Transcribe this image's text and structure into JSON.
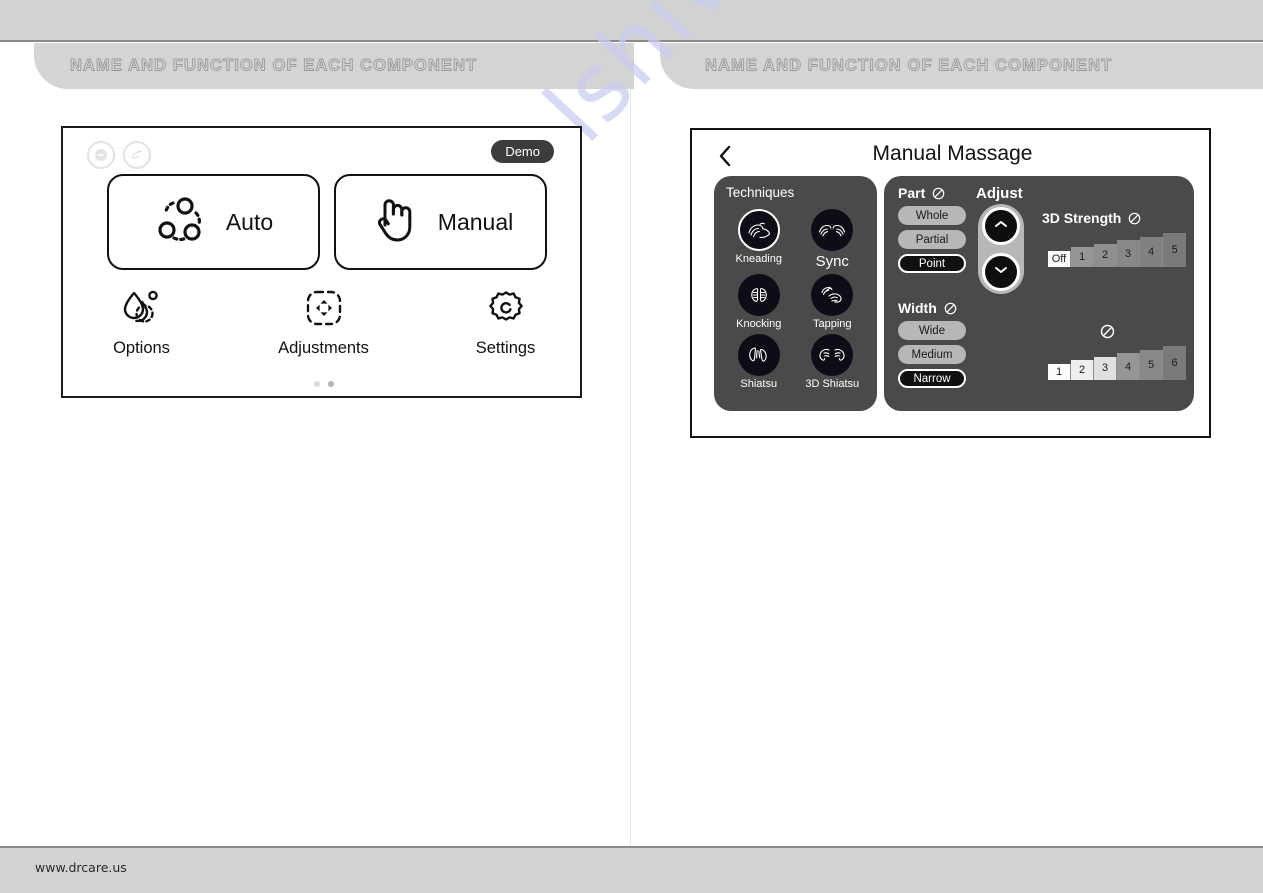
{
  "header": {
    "left_title": "NAME AND FUNCTION OF EACH COMPONENT",
    "right_title": "NAME AND FUNCTION OF EACH COMPONENT"
  },
  "watermark": {
    "text": "manualshive.com"
  },
  "footer": {
    "url": "www.drcare.us"
  },
  "left_screen": {
    "status_icons": [
      {
        "name": "minus-circle-icon"
      },
      {
        "name": "foot-massage-icon"
      }
    ],
    "demo_badge": "Demo",
    "modes": [
      {
        "label": "Auto",
        "icon": "auto-cycle-icon"
      },
      {
        "label": "Manual",
        "icon": "hand-tap-icon"
      }
    ],
    "tools": [
      {
        "label": "Options",
        "icon": "droplet-options-icon"
      },
      {
        "label": "Adjustments",
        "icon": "expand-adjust-icon"
      },
      {
        "label": "Settings",
        "icon": "gear-settings-icon"
      }
    ],
    "pagination": {
      "count": 2,
      "active_index": 1
    }
  },
  "right_screen": {
    "back_icon": "chevron-left-icon",
    "title": "Manual Massage",
    "techniques": {
      "title": "Techniques",
      "items": [
        {
          "label": "Kneading",
          "selected": true
        },
        {
          "label": "Sync",
          "selected": false
        },
        {
          "label": "Knocking",
          "selected": false
        },
        {
          "label": "Tapping",
          "selected": false
        },
        {
          "label": "Shiatsu",
          "selected": false
        },
        {
          "label": "3D Shiatsu",
          "selected": false
        }
      ]
    },
    "part": {
      "label": "Part",
      "status_icon": "prohibited-icon",
      "options": [
        {
          "label": "Whole",
          "selected": false
        },
        {
          "label": "Partial",
          "selected": false
        },
        {
          "label": "Point",
          "selected": true
        }
      ]
    },
    "width": {
      "label": "Width",
      "status_icon": "prohibited-icon",
      "options": [
        {
          "label": "Wide",
          "selected": false
        },
        {
          "label": "Medium",
          "selected": false
        },
        {
          "label": "Narrow",
          "selected": true
        }
      ]
    },
    "adjust": {
      "label": "Adjust",
      "up_icon": "chevron-up-icon",
      "down_icon": "chevron-down-icon"
    },
    "strength_3d": {
      "label": "3D Strength",
      "status_icon": "prohibited-icon",
      "levels": [
        "Off",
        "1",
        "2",
        "3",
        "4",
        "5"
      ],
      "selected_index": 0
    },
    "speed": {
      "label": "",
      "status_icon": "prohibited-icon",
      "levels": [
        "1",
        "2",
        "3",
        "4",
        "5",
        "6"
      ],
      "selected_index": 0,
      "highlight_count": 3
    }
  }
}
